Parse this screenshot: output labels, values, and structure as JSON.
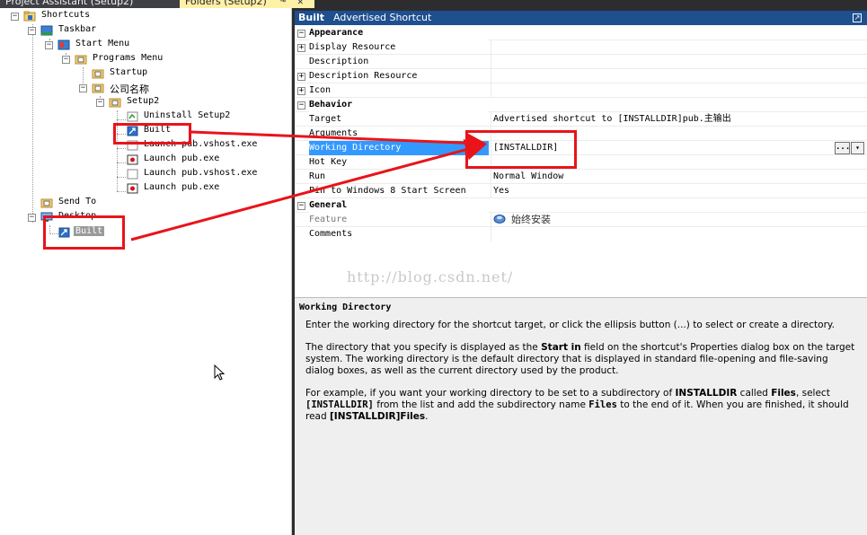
{
  "tabs": {
    "left": "Project Assistant (Setup2)",
    "right": "Folders (Setup2)",
    "pin": "⊸",
    "close": "✕"
  },
  "tree": {
    "shortcuts": "Shortcuts",
    "taskbar": "Taskbar",
    "start_menu": "Start Menu",
    "programs_menu": "Programs Menu",
    "startup": "Startup",
    "company": "公司名称",
    "setup2": "Setup2",
    "uninstall": "Uninstall Setup2",
    "built": "Built",
    "launch_vshost_1": "Launch pub.vshost.exe",
    "launch_exe_1": "Launch pub.exe",
    "launch_vshost_2": "Launch pub.vshost.exe",
    "launch_exe_2": "Launch pub.exe",
    "send_to": "Send To",
    "desktop": "Desktop",
    "desktop_built": "Built"
  },
  "header": {
    "name": "Built",
    "type": "Advertised Shortcut"
  },
  "grid": {
    "appearance": "Appearance",
    "display_resource": "Display Resource",
    "description": "Description",
    "description_resource": "Description Resource",
    "icon": "Icon",
    "behavior": "Behavior",
    "target": "Target",
    "target_value": "Advertised shortcut to [INSTALLDIR]pub.主输出",
    "arguments": "Arguments",
    "working_directory": "Working Directory",
    "working_directory_value": "[INSTALLDIR]",
    "hot_key": "Hot Key",
    "run": "Run",
    "run_value": "Normal Window",
    "pin_win8": "Pin to Windows 8 Start Screen",
    "pin_win8_value": "Yes",
    "general": "General",
    "feature": "Feature",
    "feature_value": "始终安装",
    "comments": "Comments",
    "ellipsis": "...",
    "dropdown": "▾"
  },
  "watermark": "http://blog.csdn.net/",
  "desc": {
    "title": "Working Directory",
    "p1": "Enter the working directory for the shortcut target, or click the ellipsis button (...) to select or create a directory.",
    "p2a": "The directory that you specify is displayed as the ",
    "p2b": "Start in",
    "p2c": " field on the shortcut's Properties dialog box on the target system. The working directory is the default directory that is displayed in standard file-opening and file-saving dialog boxes, as well as the current directory used by the product.",
    "p3a": "For example, if you want your working directory to be set to a subdirectory of ",
    "p3b": "INSTALLDIR",
    "p3c": " called ",
    "p3d": "Files",
    "p3e": ", select ",
    "p3f": "[INSTALLDIR]",
    "p3g": " from the list and add the subdirectory name ",
    "p3h": "Files",
    "p3i": " to the end of it. When you are finished, it should read ",
    "p3j": "[INSTALLDIR]Files",
    "p3k": "."
  },
  "colors": {
    "annotation_red": "#e8141a",
    "selection_blue": "#3399ff",
    "header_blue": "#1e4f8f"
  }
}
